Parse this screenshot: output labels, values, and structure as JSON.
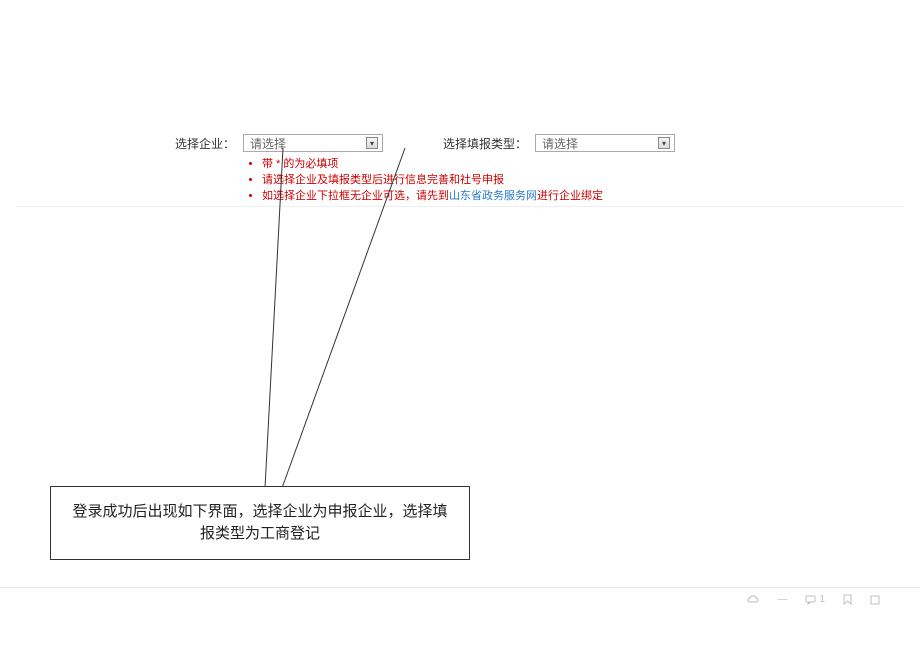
{
  "form": {
    "enterprise_label": "选择企业：",
    "enterprise_placeholder": "请选择",
    "type_label": "选择填报类型：",
    "type_placeholder": "请选择"
  },
  "hints": {
    "line1": "带 * 的为必填项",
    "line2": "请选择企业及填报类型后进行信息完善和社号申报",
    "line3_prefix": "如选择企业下拉框无企业可选，请先到",
    "line3_link": "山东省政务服务网",
    "line3_suffix": "进行企业绑定"
  },
  "callout": {
    "text": "登录成功后出现如下界面，选择企业为申报企业，选择填报类型为工商登记"
  },
  "status": {
    "count1": "1"
  }
}
